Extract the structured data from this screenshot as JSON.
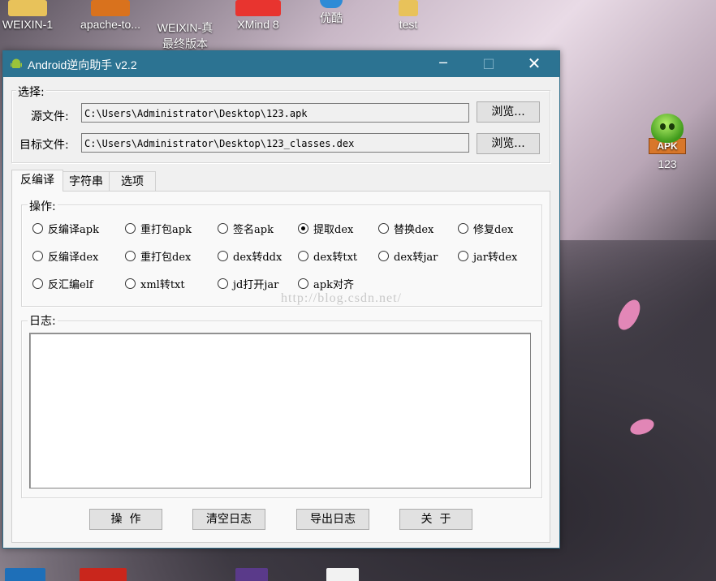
{
  "desktop": {
    "icons_top": [
      {
        "label": "WEIXIN-1"
      },
      {
        "label": "apache-to..."
      },
      {
        "label": "WEIXIN-真\n最终版本"
      },
      {
        "label": "XMind 8"
      },
      {
        "label": "优酷"
      },
      {
        "label": "test"
      }
    ],
    "apk_icon": {
      "badge": "APK",
      "label": "123"
    }
  },
  "window": {
    "title": "Android逆向助手 v2.2",
    "controls": {
      "minimize": "─",
      "maximize": "□",
      "close": "✕"
    }
  },
  "select_group": {
    "label": "选择:",
    "source": {
      "label": "源文件:",
      "value": "C:\\Users\\Administrator\\Desktop\\123.apk",
      "browse": "浏览..."
    },
    "target": {
      "label": "目标文件:",
      "value": "C:\\Users\\Administrator\\Desktop\\123_classes.dex",
      "browse": "浏览..."
    }
  },
  "tabs": [
    {
      "label": "反编译",
      "active": true
    },
    {
      "label": "字符串",
      "active": false
    },
    {
      "label": "选项",
      "active": false
    }
  ],
  "operations": {
    "label": "操作:",
    "options": [
      {
        "label": "反编译apk",
        "checked": false
      },
      {
        "label": "重打包apk",
        "checked": false
      },
      {
        "label": "签名apk",
        "checked": false
      },
      {
        "label": "提取dex",
        "checked": true
      },
      {
        "label": "替换dex",
        "checked": false
      },
      {
        "label": "修复dex",
        "checked": false
      },
      {
        "label": "反编译dex",
        "checked": false
      },
      {
        "label": "重打包dex",
        "checked": false
      },
      {
        "label": "dex转ddx",
        "checked": false
      },
      {
        "label": "dex转txt",
        "checked": false
      },
      {
        "label": "dex转jar",
        "checked": false
      },
      {
        "label": "jar转dex",
        "checked": false
      },
      {
        "label": "反汇编elf",
        "checked": false
      },
      {
        "label": "xml转txt",
        "checked": false
      },
      {
        "label": "jd打开jar",
        "checked": false
      },
      {
        "label": "apk对齐",
        "checked": false
      }
    ]
  },
  "log": {
    "label": "日志:",
    "content": ""
  },
  "watermark": "http://blog.csdn.net/",
  "buttons": {
    "operate": "操  作",
    "clear_log": "清空日志",
    "export_log": "导出日志",
    "about": "关  于"
  },
  "colors": {
    "titlebar": "#2c7392",
    "window_bg": "#f0f0f0",
    "panel_bg": "#f9f9f9"
  }
}
